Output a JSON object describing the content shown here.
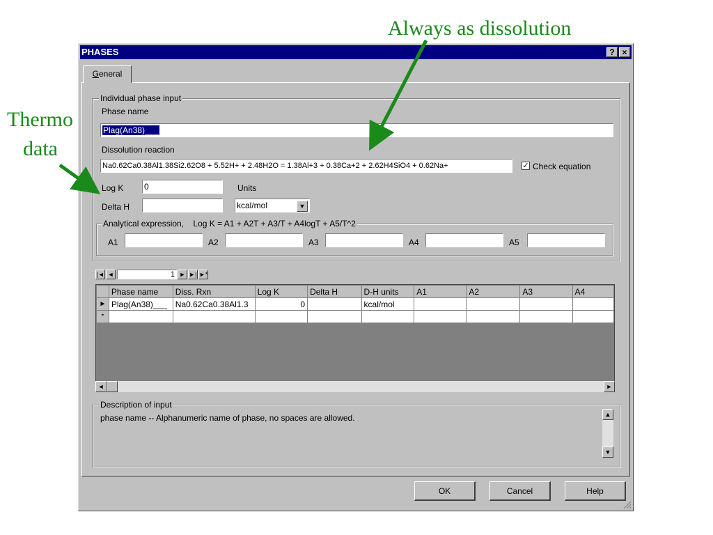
{
  "annotations": {
    "top": "Always as dissolution",
    "left_line1": "Thermo",
    "left_line2": "data"
  },
  "window": {
    "title": "PHASES",
    "help_btn": "?",
    "close_btn": "×"
  },
  "tabs": [
    {
      "label": "General",
      "selected": true
    }
  ],
  "individual": {
    "group_label": "Individual phase input",
    "phase_name_label": "Phase name",
    "phase_name_value": "Plag(An38)___",
    "dissolution_label": "Dissolution reaction",
    "dissolution_value": "Na0.62Ca0.38Al1.38Si2.62O8 + 5.52H+ + 2.48H2O = 1.38Al+3 + 0.38Ca+2 + 2.62H4SiO4 + 0.62Na+",
    "check_equation_label": "Check equation",
    "check_equation_checked": true,
    "logk_label": "Log K",
    "logk_value": "0",
    "units_label": "Units",
    "deltah_label": "Delta H",
    "deltah_value": "",
    "units_value": "kcal/mol"
  },
  "analytical": {
    "group_label": "Analytical expression,    Log K = A1 + A2T + A3/T + A4logT + A5/T^2",
    "labels": [
      "A1",
      "A2",
      "A3",
      "A4",
      "A5"
    ],
    "values": [
      "",
      "",
      "",
      "",
      ""
    ]
  },
  "navigator": {
    "first": "|◄",
    "prev": "◄",
    "record": "1",
    "next": "►",
    "last": "►|",
    "new": "►*"
  },
  "grid": {
    "columns": [
      "Phase name",
      "Diss. Rxn",
      "Log K",
      "Delta H",
      "D-H units",
      "A1",
      "A2",
      "A3",
      "A4"
    ],
    "rows": [
      {
        "marker": "►",
        "cells": [
          "Plag(An38)___",
          "Na0.62Ca0.38Al1.3",
          "0",
          "",
          "kcal/mol",
          "",
          "",
          "",
          ""
        ]
      },
      {
        "marker": "*",
        "cells": [
          "",
          "",
          "",
          "",
          "",
          "",
          "",
          "",
          ""
        ]
      }
    ]
  },
  "description": {
    "group_label": "Description of input",
    "text": "phase name -- Alphanumeric name of phase, no spaces are allowed."
  },
  "buttons": {
    "ok": "OK",
    "cancel": "Cancel",
    "help": "Help"
  },
  "colors": {
    "annotation": "#1a8a1a",
    "titlebar": "#000080",
    "face": "#c0c0c0"
  }
}
